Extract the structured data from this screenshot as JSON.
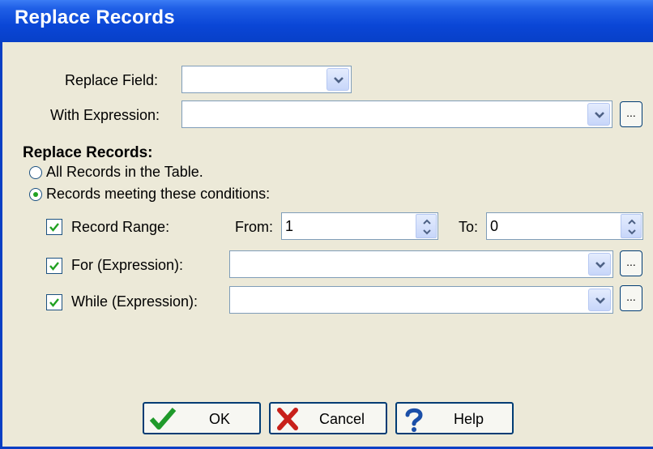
{
  "window": {
    "title": "Replace Records"
  },
  "form": {
    "replace_field_label": "Replace Field:",
    "replace_field_value": "",
    "with_expression_label": "With Expression:",
    "with_expression_value": "",
    "ellipsis": "..."
  },
  "scope": {
    "heading": "Replace Records:",
    "options": [
      {
        "label": "All Records in the Table.",
        "selected": false
      },
      {
        "label": "Records meeting these conditions:",
        "selected": true
      }
    ]
  },
  "conditions": {
    "record_range": {
      "label": "Record Range:",
      "checked": true,
      "from_label": "From:",
      "from_value": "1",
      "to_label": "To:",
      "to_value": "0"
    },
    "for_expr": {
      "label": "For (Expression):",
      "checked": true,
      "value": ""
    },
    "while_expr": {
      "label": "While (Expression):",
      "checked": true,
      "value": ""
    }
  },
  "buttons": {
    "ok": "OK",
    "cancel": "Cancel",
    "help": "Help"
  },
  "icons": {
    "ok": "checkmark-icon",
    "cancel": "x-icon",
    "help": "question-icon",
    "dropdown": "chevron-down-icon",
    "spinner": "up-down-arrows-icon"
  },
  "colors": {
    "titlebar": "#0a46d6",
    "dialog_bg": "#ECE9D8",
    "check": "#21a121",
    "cancel_x": "#c8201a",
    "help_q": "#1b4fa8"
  }
}
